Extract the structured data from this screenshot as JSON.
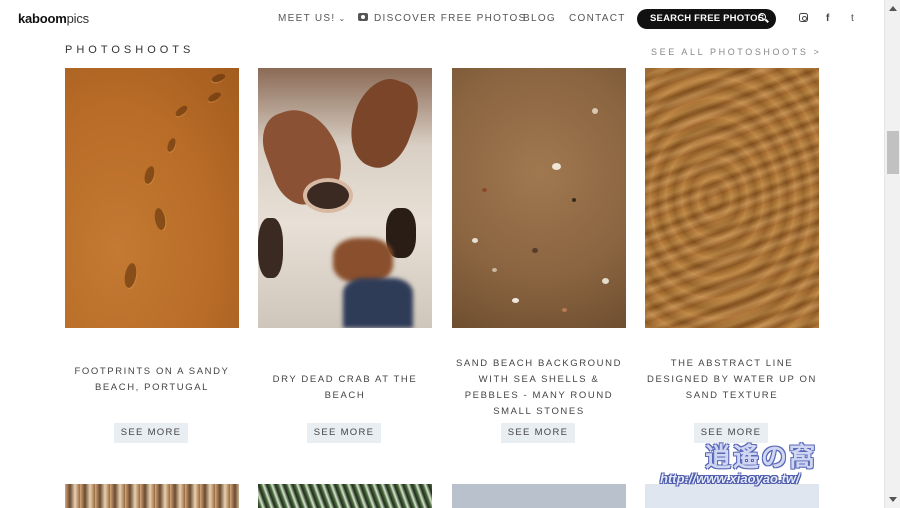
{
  "header": {
    "logo_bold": "kaboom",
    "logo_light": "pics",
    "nav": [
      {
        "label": "MEET US!",
        "chevron": "⌄"
      },
      {
        "label": "DISCOVER FREE PHOTOS",
        "icon": "camera-icon"
      },
      {
        "label": "BLOG"
      },
      {
        "label": "CONTACT"
      }
    ],
    "search_label": "SEARCH FREE PHOTOS",
    "social": [
      "instagram-icon",
      "facebook-icon",
      "twitter-icon"
    ],
    "facebook_glyph": "f",
    "twitter_glyph": "t"
  },
  "section": {
    "title": "PHOTOSHOOTS",
    "see_all": "SEE ALL PHOTOSHOOTS >"
  },
  "cards": [
    {
      "caption": "FOOTPRINTS ON A SANDY BEACH, PORTUGAL",
      "button": "SEE MORE"
    },
    {
      "caption": "DRY DEAD CRAB AT THE BEACH",
      "button": "SEE MORE"
    },
    {
      "caption": "SAND BEACH BACKGROUND WITH SEA SHELLS & PEBBLES - MANY ROUND SMALL STONES",
      "button": "SEE MORE"
    },
    {
      "caption": "THE ABSTRACT LINE DESIGNED BY WATER UP ON SAND TEXTURE",
      "button": "SEE MORE"
    }
  ],
  "watermark": {
    "title": "逍遙の窩",
    "url": "http://www.xiaoyao.tw/"
  },
  "colors": {
    "search_pill": "#111111",
    "button_bg": "#e9eef3",
    "text": "#444444"
  }
}
